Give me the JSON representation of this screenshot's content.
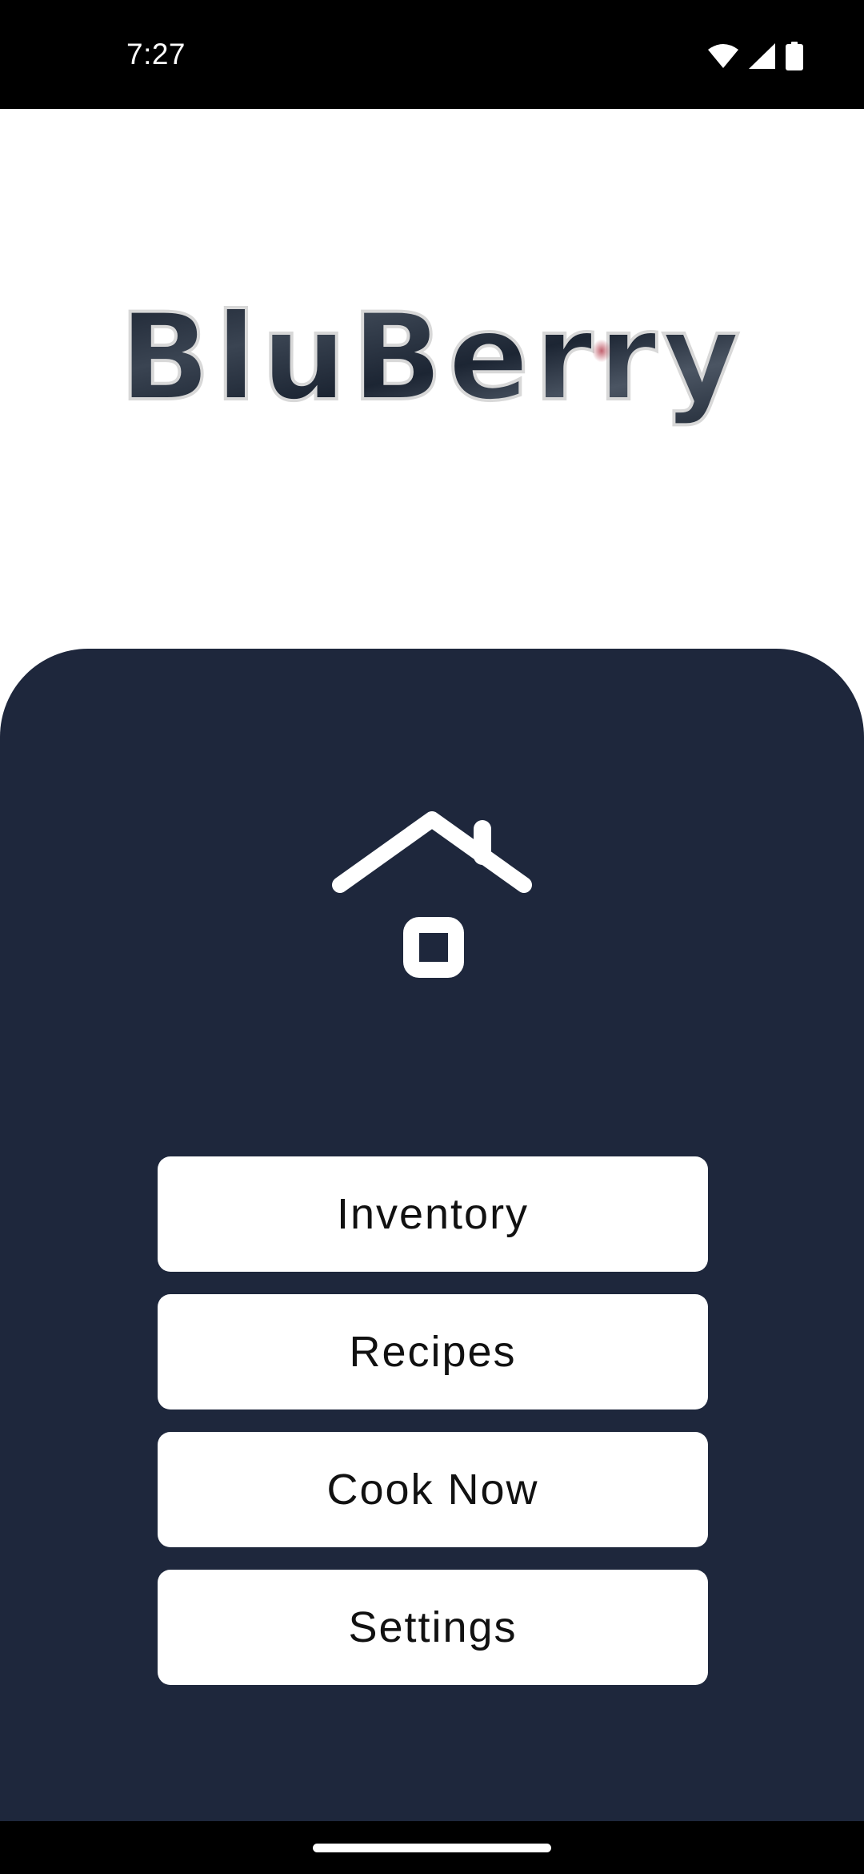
{
  "status_bar": {
    "time": "7:27",
    "icons": [
      "wifi-icon",
      "cellular-signal-icon",
      "battery-icon"
    ]
  },
  "logo": {
    "text": "BluBerry"
  },
  "home_icon": "home-icon",
  "menu": {
    "items": [
      {
        "label": "Inventory"
      },
      {
        "label": "Recipes"
      },
      {
        "label": "Cook Now"
      },
      {
        "label": "Settings"
      }
    ]
  },
  "colors": {
    "panel_background": "#1e273c",
    "button_background": "#ffffff",
    "button_text": "#111111",
    "status_bar": "#000000"
  }
}
